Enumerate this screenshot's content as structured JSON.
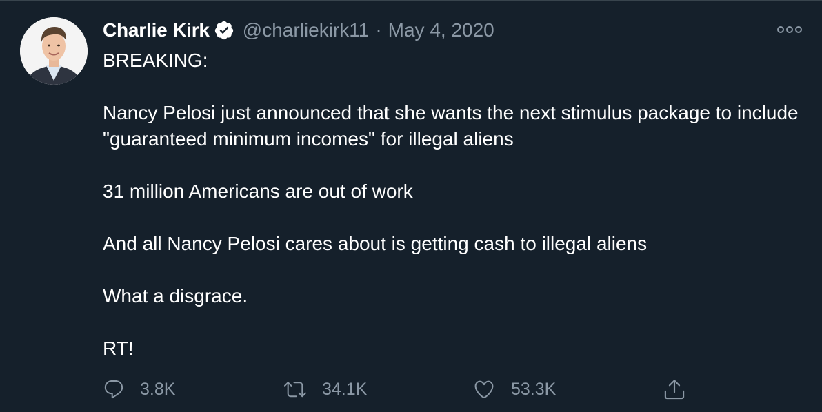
{
  "author": {
    "name": "Charlie Kirk",
    "handle": "@charliekirk11",
    "separator": "·",
    "date": "May 4, 2020",
    "verified_color": "#ffffff"
  },
  "tweet": {
    "line1": "BREAKING:",
    "para1": "Nancy Pelosi just announced that she wants the next stimulus package to include \"guaranteed minimum incomes\" for illegal aliens",
    "para2": "31 million Americans are out of work",
    "para3": "And all Nancy Pelosi cares about is getting cash to illegal aliens",
    "para4": "What a disgrace.",
    "para5": "RT!"
  },
  "actions": {
    "replies": "3.8K",
    "retweets": "34.1K",
    "likes": "53.3K"
  },
  "icons": {
    "more": "more-options-icon",
    "reply": "reply-icon",
    "retweet": "retweet-icon",
    "like": "heart-icon",
    "share": "share-icon"
  },
  "colors": {
    "background": "#15202b",
    "secondary_text": "#8b98a5",
    "primary_text": "#ffffff"
  }
}
